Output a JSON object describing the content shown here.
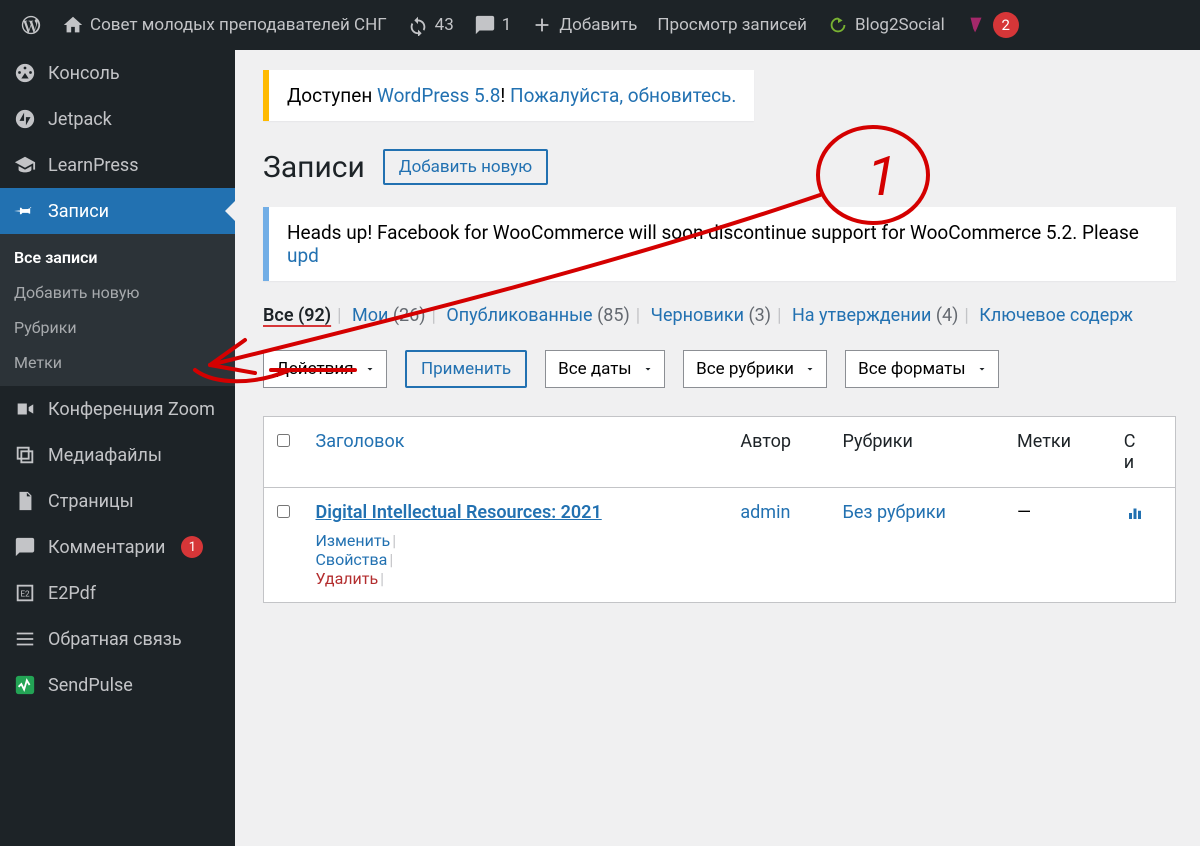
{
  "adminbar": {
    "site_title": "Совет молодых преподавателей СНГ",
    "update_count": "43",
    "comment_count": "1",
    "add_new": "Добавить",
    "view_label": "Просмотр записей",
    "blog2social": "Blog2Social",
    "yoast_count": "2"
  },
  "sidebar": {
    "items": [
      {
        "label": "Консоль"
      },
      {
        "label": "Jetpack"
      },
      {
        "label": "LearnPress"
      },
      {
        "label": "Записи"
      },
      {
        "label": "Конференция Zoom"
      },
      {
        "label": "Медиафайлы"
      },
      {
        "label": "Страницы"
      },
      {
        "label": "Комментарии",
        "count": "1"
      },
      {
        "label": "E2Pdf"
      },
      {
        "label": "Обратная связь"
      },
      {
        "label": "SendPulse"
      }
    ],
    "sub": [
      {
        "label": "Все записи"
      },
      {
        "label": "Добавить новую"
      },
      {
        "label": "Рубрики"
      },
      {
        "label": "Метки"
      }
    ]
  },
  "main": {
    "update_notice_pre": "Доступен ",
    "update_notice_link": "WordPress 5.8",
    "update_notice_mid": "! ",
    "update_notice_link2": "Пожалуйста, обновитесь.",
    "page_title": "Записи",
    "add_new_btn": "Добавить новую",
    "info_notice_pre": "Heads up! Facebook for WooCommerce will soon discontinue support for WooCommerce 5.2. Please ",
    "info_notice_link": "upd",
    "filters": {
      "all": "Все",
      "all_count": "(92)",
      "mine": "Мои",
      "mine_count": "(26)",
      "published": "Опубликованные",
      "published_count": "(85)",
      "drafts": "Черновики",
      "drafts_count": "(3)",
      "pending": "На утверждении",
      "pending_count": "(4)",
      "cornerstone": "Ключевое содерж"
    },
    "bulk_actions": "Действия",
    "apply": "Применить",
    "all_dates": "Все даты",
    "all_cats": "Все рубрики",
    "all_formats": "Все форматы",
    "table": {
      "col_title": "Заголовок",
      "col_author": "Автор",
      "col_cats": "Рубрики",
      "col_tags": "Метки",
      "col_stats": "С",
      "col_stats2": "и"
    },
    "rows": [
      {
        "title": "Digital Intellectual Resources: 2021",
        "author": "admin",
        "cats": "Без рубрики",
        "tags": "—",
        "edit": "Изменить",
        "quick": "Свойства",
        "trash": "Удалить"
      }
    ]
  },
  "annotation": {
    "number": "1"
  }
}
